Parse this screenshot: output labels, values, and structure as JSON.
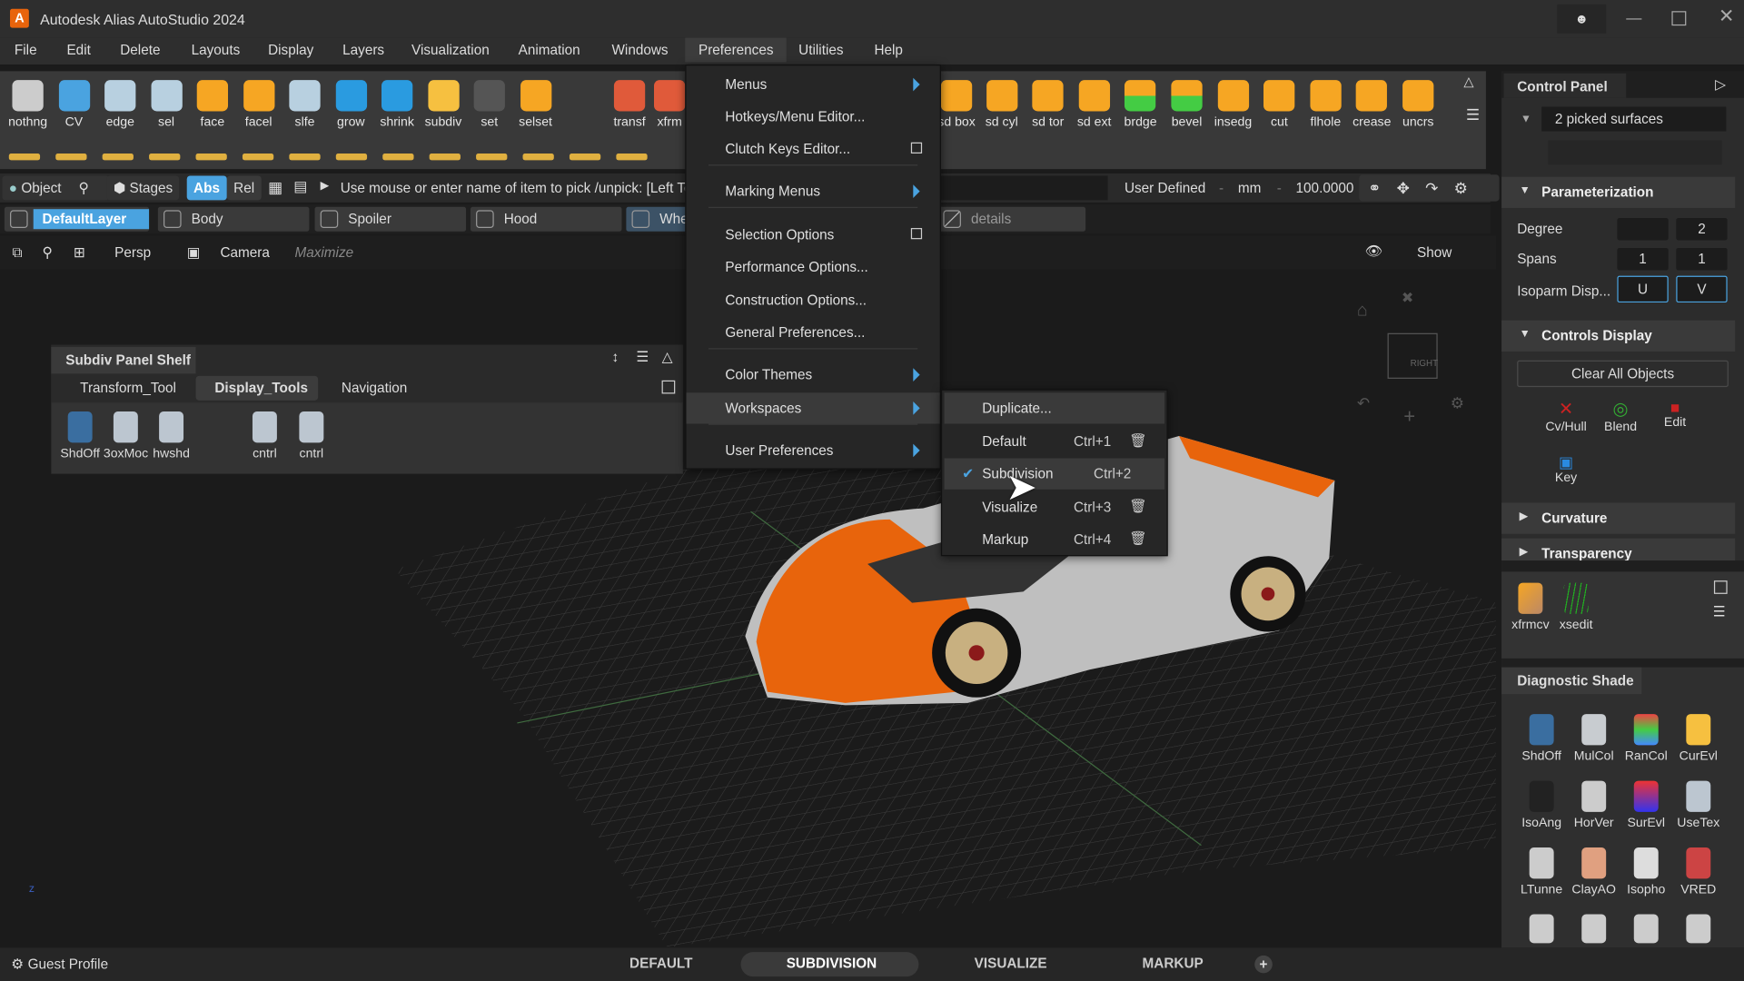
{
  "window": {
    "title": "Autodesk Alias AutoStudio 2024",
    "logo": "A"
  },
  "menubar": [
    "File",
    "Edit",
    "Delete",
    "Layouts",
    "Display",
    "Layers",
    "Visualization",
    "Animation",
    "Windows",
    "Preferences",
    "Utilities",
    "Help"
  ],
  "toolbar_left": [
    "nothng",
    "CV",
    "edge",
    "sel",
    "face",
    "facel",
    "slfe",
    "grow",
    "shrink",
    "subdiv",
    "set",
    "selset"
  ],
  "toolbar_mid": [
    "transf",
    "xfrm"
  ],
  "toolbar_right": [
    "sd box",
    "sd cyl",
    "sd tor",
    "sd ext",
    "brdge",
    "bevel",
    "insedg",
    "cut",
    "flhole",
    "crease",
    "uncrs"
  ],
  "pickbar": {
    "object": "Object",
    "stages": "Stages",
    "abs": "Abs",
    "rel": "Rel",
    "prompt": "Use mouse or enter name of item to pick /unpick: [Left Toggle",
    "units_mode": "User Defined",
    "dash1": "-",
    "unit": "mm",
    "dash2": "-",
    "value": "100.0000"
  },
  "layers": [
    "DefaultLayer",
    "Body",
    "Spoiler",
    "Hood",
    "Whe",
    "details"
  ],
  "viewbar": {
    "persp": "Persp",
    "camera": "Camera",
    "maximize": "Maximize",
    "show": "Show"
  },
  "viewcube": {
    "face": "RIGHT"
  },
  "shelf": {
    "title": "Subdiv Panel Shelf",
    "tabs": [
      "Transform_Tool",
      "Display_Tools",
      "Navigation"
    ],
    "active_tab": 1,
    "tools": [
      "ShdOff",
      "3oxMoc",
      "hwshd",
      "cntrl",
      "cntrl"
    ]
  },
  "pref_menu": {
    "items": [
      {
        "label": "Menus",
        "type": "submenu"
      },
      {
        "label": "Hotkeys/Menu Editor...",
        "type": "item"
      },
      {
        "label": "Clutch Keys Editor...",
        "type": "option"
      },
      {
        "label": "Marking Menus",
        "type": "submenu"
      },
      {
        "label": "Selection Options",
        "type": "option"
      },
      {
        "label": "Performance Options...",
        "type": "item"
      },
      {
        "label": "Construction Options...",
        "type": "item"
      },
      {
        "label": "General Preferences...",
        "type": "item"
      },
      {
        "label": "Color Themes",
        "type": "submenu"
      },
      {
        "label": "Workspaces",
        "type": "submenu"
      },
      {
        "label": "User Preferences",
        "type": "submenu"
      }
    ]
  },
  "workspaces_menu": {
    "items": [
      {
        "label": "Duplicate...",
        "shortcut": ""
      },
      {
        "label": "Default",
        "shortcut": "Ctrl+1"
      },
      {
        "label": "Subdivision",
        "shortcut": "Ctrl+2",
        "checked": true
      },
      {
        "label": "Visualize",
        "shortcut": "Ctrl+3"
      },
      {
        "label": "Markup",
        "shortcut": "Ctrl+4"
      }
    ]
  },
  "control_panel": {
    "title": "Control Panel",
    "picked": "2 picked surfaces",
    "parameterization": {
      "title": "Parameterization",
      "degree_label": "Degree",
      "degree": [
        "",
        "2"
      ],
      "spans_label": "Spans",
      "spans": [
        "1",
        "1"
      ],
      "isoparm_label": "Isoparm Disp...",
      "u": "U",
      "v": "V"
    },
    "controls_display": {
      "title": "Controls Display",
      "clear": "Clear All Objects",
      "items": [
        "Cv/Hull",
        "Blend",
        "Edit",
        "Key"
      ]
    },
    "curvature": "Curvature",
    "transparency": "Transparency"
  },
  "mini_shelf": [
    "xfrmcv",
    "xsedit"
  ],
  "diagnostic": {
    "title": "Diagnostic Shade",
    "items": [
      "ShdOff",
      "MulCol",
      "RanCol",
      "CurEvl",
      "IsoAng",
      "HorVer",
      "SurEvl",
      "UseTex",
      "LTunne",
      "ClayAO",
      "Isopho",
      "VRED"
    ]
  },
  "bottom": {
    "profile": "Guest Profile",
    "workspaces": [
      "DEFAULT",
      "SUBDIVISION",
      "VISUALIZE",
      "MARKUP"
    ],
    "active": "SUBDIVISION"
  },
  "colors": {
    "accent": "#4aa3e0",
    "body_orange": "#e8640c",
    "panel": "#2c2c2c"
  }
}
